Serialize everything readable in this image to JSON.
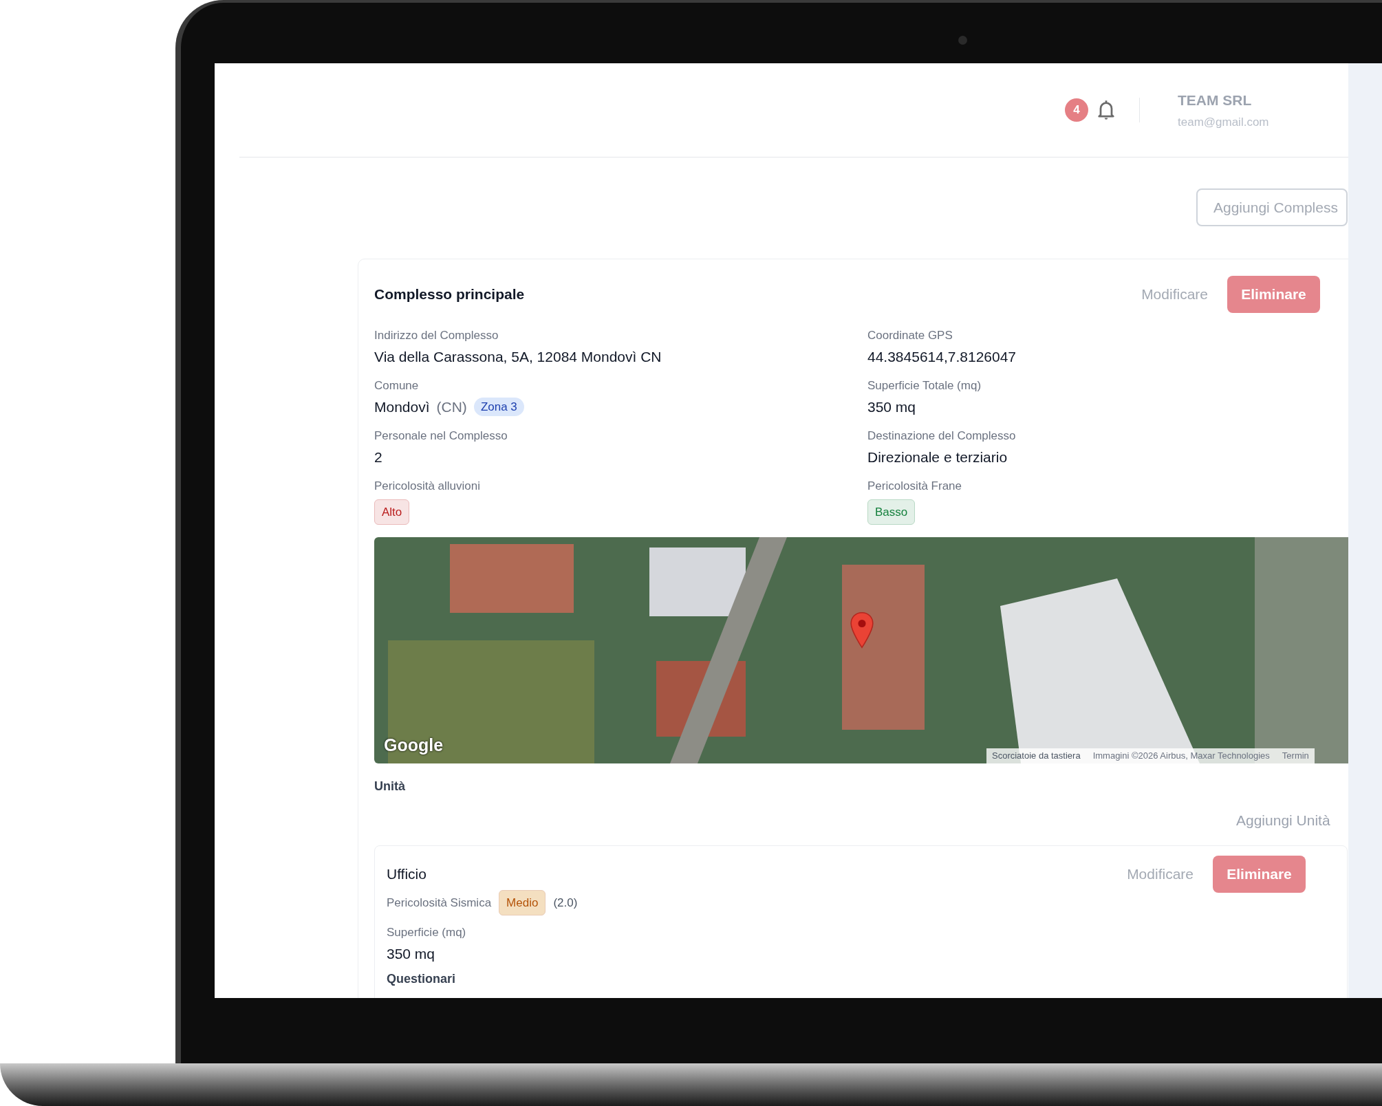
{
  "header": {
    "notification_count": "4",
    "company": "TEAM SRL",
    "email": "team@gmail.com"
  },
  "add_complex_button": "Aggiungi Compless",
  "complex": {
    "title": "Complesso principale",
    "edit_button": "Modificare",
    "delete_button": "Eliminare",
    "fields": [
      {
        "kind": "text",
        "label": "Indirizzo del Complesso",
        "value": "Via della Carassona, 5A, 12084 Mondovì CN"
      },
      {
        "kind": "text",
        "label": "Coordinate GPS",
        "value": "44.3845614,7.8126047"
      },
      {
        "kind": "place",
        "label": "Comune",
        "value": "Mondovì",
        "province": "(CN)",
        "zone": "Zona 3"
      },
      {
        "kind": "text",
        "label": "Superficie Totale (mq)",
        "value": "350 mq"
      },
      {
        "kind": "text",
        "label": "Personale nel Complesso",
        "value": "2"
      },
      {
        "kind": "text",
        "label": "Destinazione del Complesso",
        "value": "Direzionale e terziario"
      },
      {
        "kind": "risk",
        "label": "Pericolosità alluvioni",
        "value": "Alto",
        "color": "#b91c1c"
      },
      {
        "kind": "risk",
        "label": "Pericolosità Frane",
        "value": "Basso",
        "color": "#15803d"
      }
    ],
    "map": {
      "logo": "Google",
      "attribution": [
        "Scorciatoie da tastiera",
        "Immagini ©2026 Airbus, Maxar Technologies",
        "Termin"
      ]
    }
  },
  "units_section": {
    "title": "Unità",
    "add_button": "Aggiungi Unità",
    "units": [
      {
        "name": "Ufficio",
        "edit_button": "Modificare",
        "delete_button": "Eliminare",
        "seismic_label": "Pericolosità Sismica",
        "seismic_level": {
          "label": "Medio",
          "color": "#b45309"
        },
        "seismic_value": "(2.0)",
        "area_label": "Superficie (mq)",
        "area_value": "350 mq",
        "next_section": "Questionari"
      }
    ]
  }
}
